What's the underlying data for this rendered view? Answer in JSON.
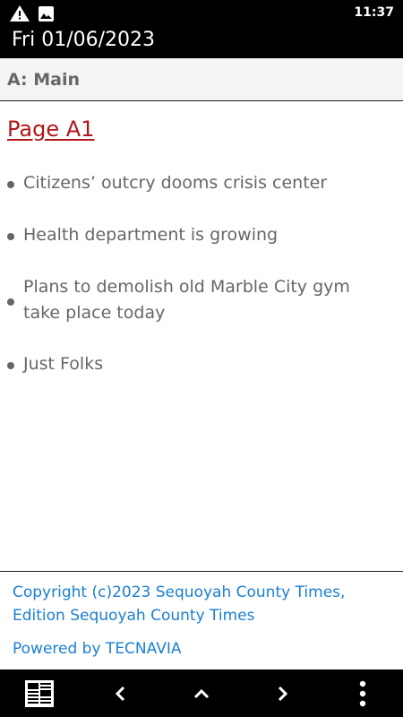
{
  "status_bar": {
    "time": "11:37",
    "icons": [
      "warning-icon",
      "image-icon"
    ]
  },
  "title_bar": {
    "date": "Fri 01/06/2023"
  },
  "section": {
    "label": "A: Main"
  },
  "page": {
    "link_label": "Page A1",
    "link_color": "#b0171a"
  },
  "articles": [
    "Citizens’ outcry dooms crisis center",
    "Health department is growing",
    "Plans to demolish old Marble City gym take place today",
    "Just Folks"
  ],
  "footer": {
    "copyright": "Copyright (c)2023 Sequoyah County Times, Edition Sequoyah County Times",
    "powered_by": "Powered by TECNAVIA",
    "link_color": "#1a7fd0"
  },
  "bottom_bar": {
    "icons": [
      "newspaper-icon",
      "chevron-left-icon",
      "chevron-up-icon",
      "chevron-right-icon",
      "more-vertical-icon"
    ]
  }
}
